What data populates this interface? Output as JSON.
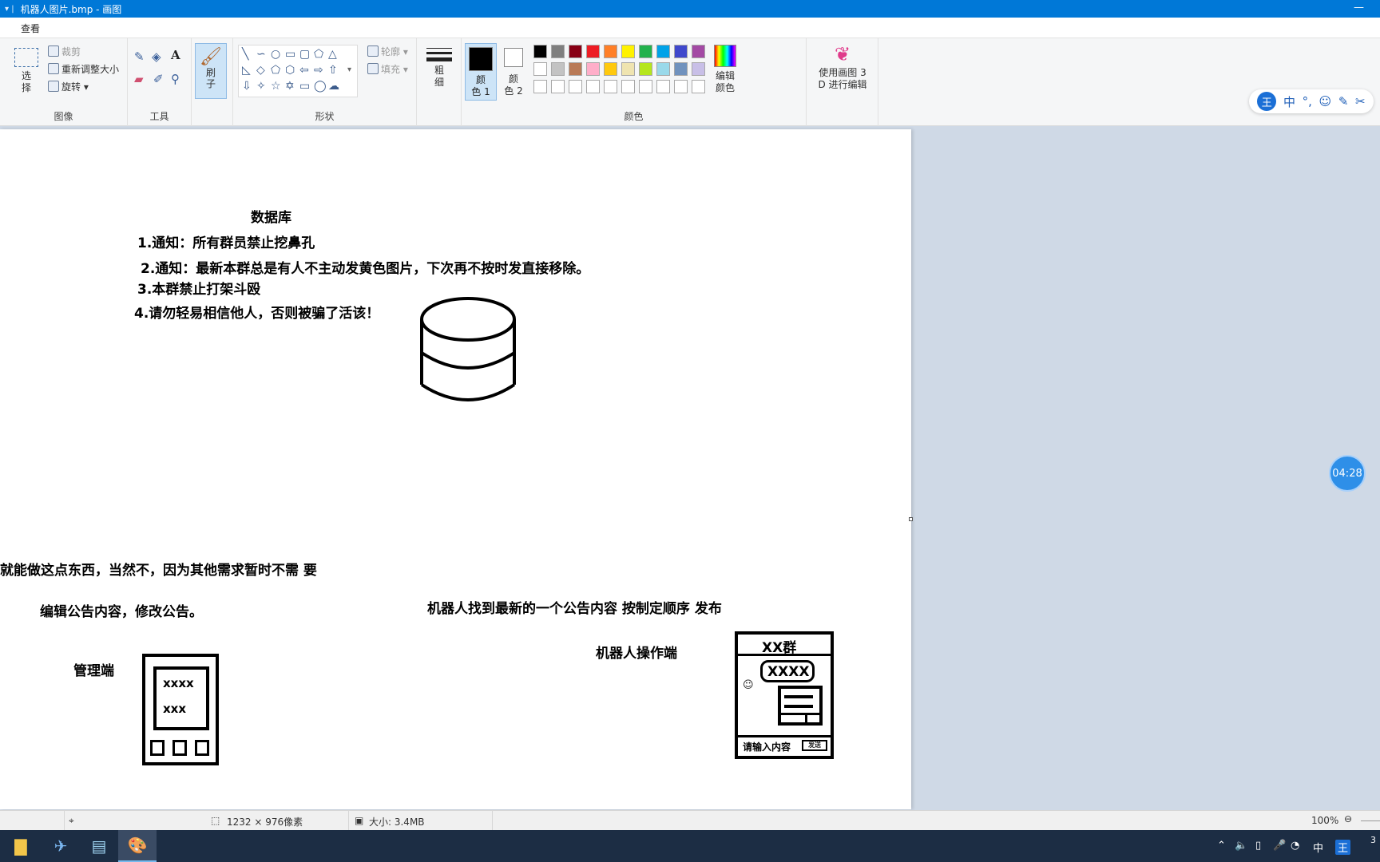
{
  "window": {
    "title": "机器人图片.bmp - 画图"
  },
  "menu": {
    "view": "查看"
  },
  "ribbon": {
    "image": {
      "label": "图像",
      "select": "选\n择",
      "crop": "裁剪",
      "resize": "重新调整大小",
      "rotate": "旋转"
    },
    "tools": {
      "label": "工具"
    },
    "brush": {
      "label": "刷\n子"
    },
    "shapes": {
      "label": "形状",
      "outline": "轮廓",
      "fill": "填充"
    },
    "size": {
      "label": "粗\n细"
    },
    "colors": {
      "label": "颜色",
      "color1": "颜\n色 1",
      "color2": "颜\n色 2",
      "edit": "编辑\n颜色",
      "row1": [
        "#000000",
        "#7f7f7f",
        "#880015",
        "#ed1c24",
        "#ff7f27",
        "#fff200",
        "#22b14c",
        "#00a2e8",
        "#3f48cc",
        "#a349a4"
      ],
      "row2": [
        "#ffffff",
        "#c3c3c3",
        "#b97a57",
        "#ffaec9",
        "#ffc90e",
        "#efe4b0",
        "#b5e61d",
        "#99d9ea",
        "#7092be",
        "#c8bfe7"
      ]
    },
    "paint3d": {
      "label": "使用画图 3\nD 进行编辑"
    }
  },
  "ime": {
    "logo": "王",
    "lang": "中",
    "punct": "°,",
    "emoji": "☺",
    "pen": "✎",
    "tool": "✂"
  },
  "canvas": {
    "db_title": "数据库",
    "line1": "1.通知：所有群员禁止挖鼻孔",
    "line2": "2.通知：最新本群总是有人不主动发黄色图片，下次再不按时发直接移除。",
    "line3": "3.本群禁止打架斗殴",
    "line4": "4.请勿轻易相信他人，否则被骗了活该！",
    "note": "就能做这点东西，当然不，因为其他需求暂时不需 要",
    "edit_note": "编辑公告内容，修改公告。",
    "robot_note": "机器人找到最新的一个公告内容 按制定顺序 发布",
    "admin_label": "管理端",
    "admin_text1": "xxxx",
    "admin_text2": "xxx",
    "robot_label": "机器人操作端",
    "group_title": "XX群",
    "bubble": "XXXX",
    "input_hint": "请输入内容",
    "send": "发送"
  },
  "timer": "04:28",
  "status": {
    "dimensions": "1232 × 976像素",
    "size": "大小: 3.4MB",
    "zoom": "100%"
  },
  "tray": {
    "lang": "中",
    "ime": "王",
    "clock": "3"
  }
}
